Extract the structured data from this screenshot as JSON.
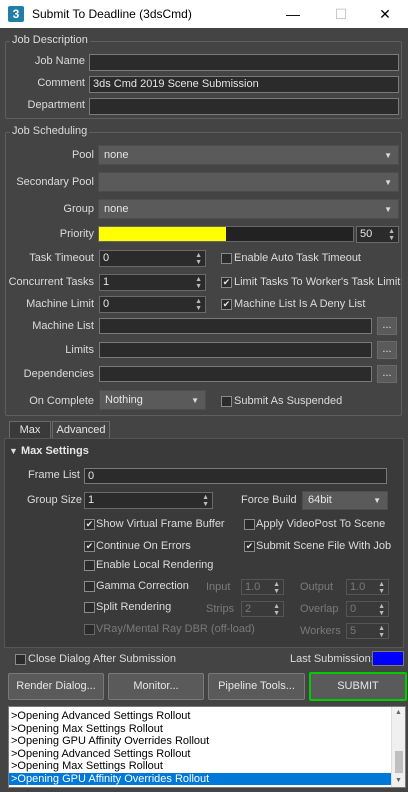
{
  "window": {
    "app_icon": "3",
    "title": "Submit To Deadline (3dsCmd)",
    "controls": [
      "—",
      "☐",
      "✕"
    ]
  },
  "job_description": {
    "group_label": "Job Description",
    "job_name_label": "Job Name",
    "job_name_value": "",
    "comment_label": "Comment",
    "comment_value": "3ds Cmd 2019 Scene Submission",
    "department_label": "Department",
    "department_value": ""
  },
  "job_scheduling": {
    "group_label": "Job Scheduling",
    "pool_label": "Pool",
    "pool_value": "none",
    "secondary_pool_label": "Secondary Pool",
    "secondary_pool_value": "",
    "group_field_label": "Group",
    "group_value": "none",
    "priority_label": "Priority",
    "priority_value": "50",
    "priority_fraction": 0.5,
    "task_timeout_label": "Task Timeout",
    "task_timeout_value": "0",
    "auto_task_timeout_label": "Enable Auto Task Timeout",
    "auto_task_timeout_checked": false,
    "concurrent_tasks_label": "Concurrent Tasks",
    "concurrent_tasks_value": "1",
    "limit_tasks_label": "Limit Tasks To Worker's Task Limit",
    "limit_tasks_checked": true,
    "machine_limit_label": "Machine Limit",
    "machine_limit_value": "0",
    "deny_list_label": "Machine List Is A Deny List",
    "deny_list_checked": true,
    "machine_list_label": "Machine List",
    "limits_label": "Limits",
    "dependencies_label": "Dependencies",
    "browse_label": "...",
    "on_complete_label": "On Complete",
    "on_complete_value": "Nothing",
    "submit_suspended_label": "Submit As Suspended",
    "submit_suspended_checked": false
  },
  "tabs": [
    "Max",
    "Advanced"
  ],
  "max_settings": {
    "header": "Max Settings",
    "frame_list_label": "Frame List",
    "frame_list_value": "0",
    "group_size_label": "Group Size",
    "group_size_value": "1",
    "force_build_label": "Force Build",
    "force_build_value": "64bit",
    "show_vfb_label": "Show Virtual Frame Buffer",
    "show_vfb_checked": true,
    "apply_videopost_label": "Apply VideoPost To Scene",
    "apply_videopost_checked": false,
    "continue_on_errors_label": "Continue On Errors",
    "continue_on_errors_checked": true,
    "submit_scene_label": "Submit Scene File With Job",
    "submit_scene_checked": true,
    "local_rendering_label": "Enable Local Rendering",
    "local_rendering_checked": false,
    "gamma_label": "Gamma Correction",
    "gamma_checked": false,
    "input_label": "Input",
    "input_value": "1.0",
    "output_label": "Output",
    "output_value": "1.0",
    "split_label": "Split Rendering",
    "split_checked": false,
    "strips_label": "Strips",
    "strips_value": "2",
    "overlap_label": "Overlap",
    "overlap_value": "0",
    "dbr_label": "VRay/Mental Ray DBR (off-load)",
    "dbr_checked": false,
    "workers_label": "Workers",
    "workers_value": "5"
  },
  "footer": {
    "close_dialog_label": "Close Dialog After Submission",
    "close_dialog_checked": false,
    "last_submission_label": "Last Submission:",
    "last_submission_color": "#0000ff",
    "render_dialog_label": "Render Dialog...",
    "monitor_label": "Monitor...",
    "pipeline_tools_label": "Pipeline Tools...",
    "submit_label": "SUBMIT"
  },
  "log": [
    ">Opening Advanced Settings Rollout",
    ">Opening Max Settings Rollout",
    ">Opening GPU Affinity Overrides Rollout",
    ">Opening Advanced Settings Rollout",
    ">Opening Max Settings Rollout",
    ">Opening GPU Affinity Overrides Rollout"
  ],
  "colors": {
    "priority_bar": "#ffff00",
    "submit_border": "#00cc00",
    "selection": "#0078d7"
  }
}
